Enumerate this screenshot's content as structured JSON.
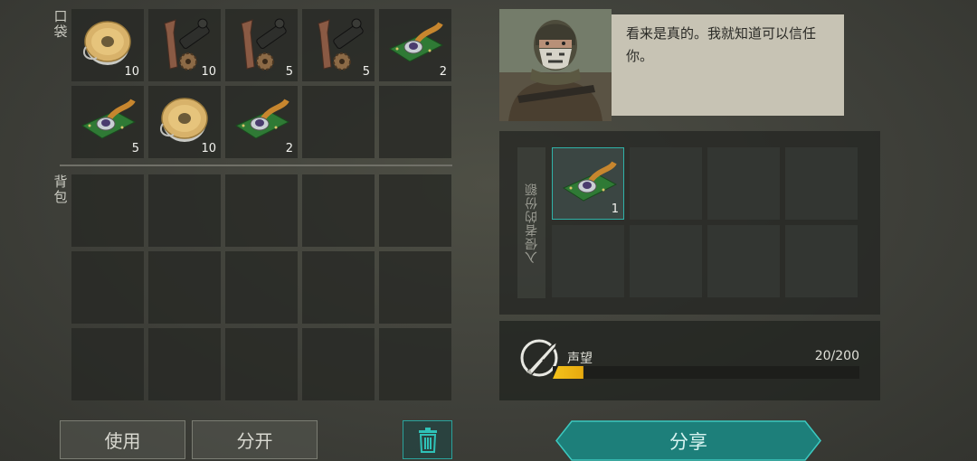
{
  "inventory": {
    "pocket_label": "口袋",
    "backpack_label": "背包",
    "pocket_slots": [
      {
        "item": "wire-spool",
        "qty": "10"
      },
      {
        "item": "gun-parts",
        "qty": "10"
      },
      {
        "item": "gun-parts",
        "qty": "5"
      },
      {
        "item": "gun-parts",
        "qty": "5"
      },
      {
        "item": "circuit-board",
        "qty": "2"
      },
      {
        "item": "circuit-board",
        "qty": "5"
      },
      {
        "item": "wire-spool",
        "qty": "10"
      },
      {
        "item": "circuit-board",
        "qty": "2"
      },
      {
        "item": "",
        "qty": ""
      },
      {
        "item": "",
        "qty": ""
      }
    ]
  },
  "actions": {
    "use_label": "使用",
    "split_label": "分开"
  },
  "npc": {
    "dialogue": "看来是真的。我就知道可以信任你。"
  },
  "share_area": {
    "label": "入侵者的份额",
    "slots": [
      {
        "item": "circuit-board",
        "qty": "1"
      }
    ]
  },
  "reputation": {
    "label": "声望",
    "value_text": "20/200",
    "progress": 0.1
  },
  "share_button": {
    "label": "分享"
  },
  "colors": {
    "accent_teal": "#2aa39c",
    "progress_yellow": "#f4c21c"
  }
}
